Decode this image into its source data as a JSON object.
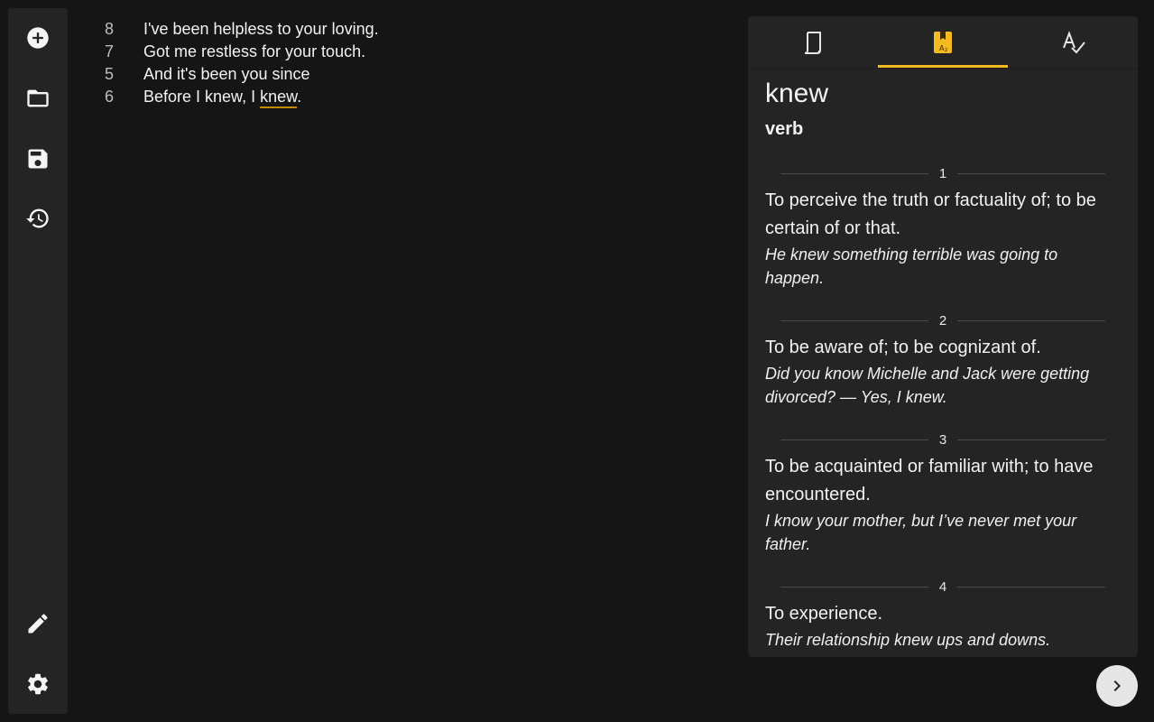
{
  "sidebar": {
    "top_icons": [
      "add-circle-icon",
      "folder-icon",
      "save-icon",
      "history-icon"
    ],
    "bottom_icons": [
      "pencil-icon",
      "gear-icon"
    ]
  },
  "editor": {
    "lines": [
      {
        "num": "8",
        "text": "I've been helpless to your loving."
      },
      {
        "num": "7",
        "text": "Got me restless for your touch."
      },
      {
        "num": "5",
        "text": "And it's been you since"
      },
      {
        "num": "6",
        "text_before": "Before I knew, I ",
        "text_underlined": "knew",
        "text_after": "."
      }
    ]
  },
  "panel": {
    "tabs": [
      {
        "icon": "document-icon",
        "active": false
      },
      {
        "icon": "dictionary-icon",
        "active": true
      },
      {
        "icon": "spellcheck-icon",
        "active": false
      }
    ],
    "accent_color": "#f5b921",
    "word": "knew",
    "part_of_speech": "verb",
    "senses": [
      {
        "num": "1",
        "definition": "To perceive the truth or factuality of; to be certain of or that.",
        "example": "He knew something terrible was going to happen."
      },
      {
        "num": "2",
        "definition": "To be aware of; to be cognizant of.",
        "example": "Did you know Michelle and Jack were getting divorced? — Yes, I knew."
      },
      {
        "num": "3",
        "definition": "To be acquainted or familiar with; to have encountered.",
        "example": "I know your mother, but I’ve never met your father."
      },
      {
        "num": "4",
        "definition": "To experience.",
        "example": "Their relationship knew ups and downs."
      }
    ]
  },
  "next_button": {
    "icon": "chevron-right-icon"
  }
}
